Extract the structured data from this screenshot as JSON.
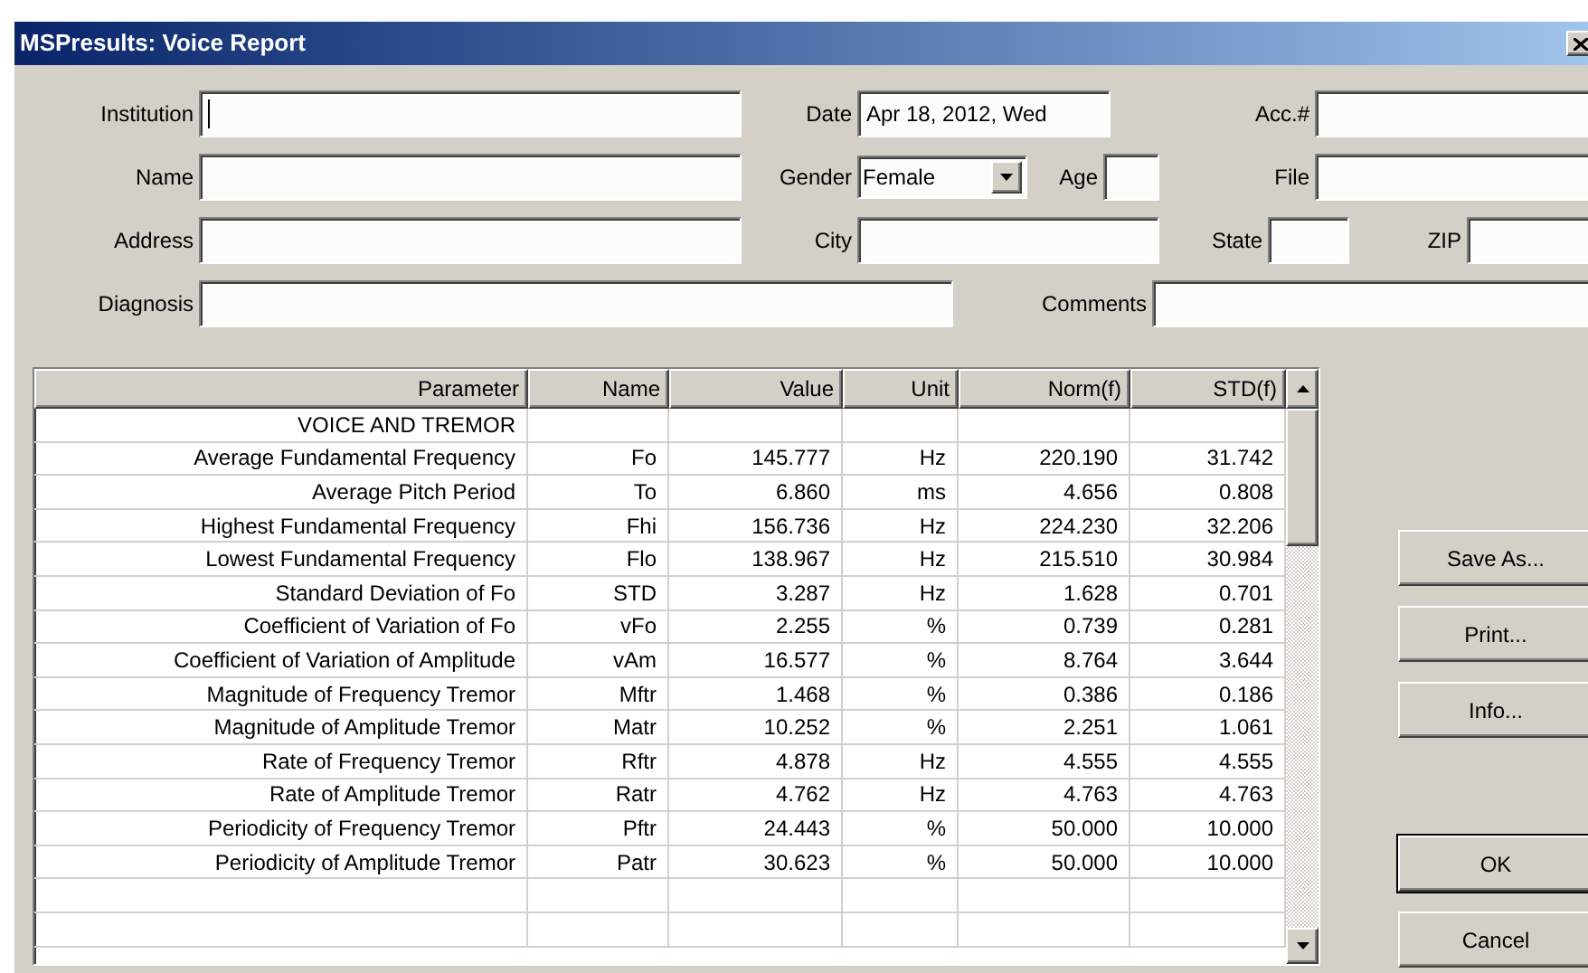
{
  "window": {
    "title": "MSPresults: Voice Report"
  },
  "form": [
    [
      {
        "kind": "text",
        "label": "Institution",
        "focused": true
      },
      {
        "kind": "text",
        "label": "Date",
        "value": "Apr 18, 2012, Wed"
      },
      {
        "kind": "text",
        "label": "Acc.#"
      }
    ],
    [
      {
        "kind": "text",
        "label": "Name"
      },
      {
        "kind": "select",
        "label": "Gender",
        "value": "Female"
      },
      {
        "kind": "text",
        "label": "Age"
      },
      {
        "kind": "text",
        "label": "File"
      }
    ],
    [
      {
        "kind": "text",
        "label": "Address"
      },
      {
        "kind": "text",
        "label": "City"
      },
      {
        "kind": "text",
        "label": "State"
      },
      {
        "kind": "text",
        "label": "ZIP"
      }
    ],
    [
      {
        "kind": "text",
        "label": "Diagnosis"
      },
      {
        "kind": "text",
        "label": "Comments"
      }
    ]
  ],
  "table": {
    "columns": [
      "Parameter",
      "Name",
      "Value",
      "Unit",
      "Norm(f)",
      "STD(f)"
    ],
    "rows": [
      [
        "VOICE AND TREMOR"
      ],
      [
        "Average Fundamental Frequency",
        "Fo",
        "145.777",
        "Hz",
        "220.190",
        "31.742"
      ],
      [
        "Average Pitch Period",
        "To",
        "6.860",
        "ms",
        "4.656",
        "0.808"
      ],
      [
        "Highest Fundamental Frequency",
        "Fhi",
        "156.736",
        "Hz",
        "224.230",
        "32.206"
      ],
      [
        "Lowest Fundamental Frequency",
        "Flo",
        "138.967",
        "Hz",
        "215.510",
        "30.984"
      ],
      [
        "Standard Deviation of Fo",
        "STD",
        "3.287",
        "Hz",
        "1.628",
        "0.701"
      ],
      [
        "Coefficient of Variation of Fo",
        "vFo",
        "2.255",
        "%",
        "0.739",
        "0.281"
      ],
      [
        "Coefficient of Variation of Amplitude",
        "vAm",
        "16.577",
        "%",
        "8.764",
        "3.644"
      ],
      [
        "Magnitude of Frequency Tremor",
        "Mftr",
        "1.468",
        "%",
        "0.386",
        "0.186"
      ],
      [
        "Magnitude of Amplitude Tremor",
        "Matr",
        "10.252",
        "%",
        "2.251",
        "1.061"
      ],
      [
        "Rate of Frequency Tremor",
        "Rftr",
        "4.878",
        "Hz",
        "4.555",
        "4.555"
      ],
      [
        "Rate of Amplitude Tremor",
        "Ratr",
        "4.762",
        "Hz",
        "4.763",
        "4.763"
      ],
      [
        "Periodicity of Frequency Tremor",
        "Pftr",
        "24.443",
        "%",
        "50.000",
        "10.000"
      ],
      [
        "Periodicity of Amplitude Tremor",
        "Patr",
        "30.623",
        "%",
        "50.000",
        "10.000"
      ]
    ]
  },
  "buttons": [
    {
      "label": "Save As...",
      "default": false
    },
    {
      "label": "Print...",
      "default": false
    },
    {
      "label": "Info...",
      "default": false
    },
    {
      "label": "OK",
      "default": true
    },
    {
      "label": "Cancel",
      "default": false
    }
  ]
}
